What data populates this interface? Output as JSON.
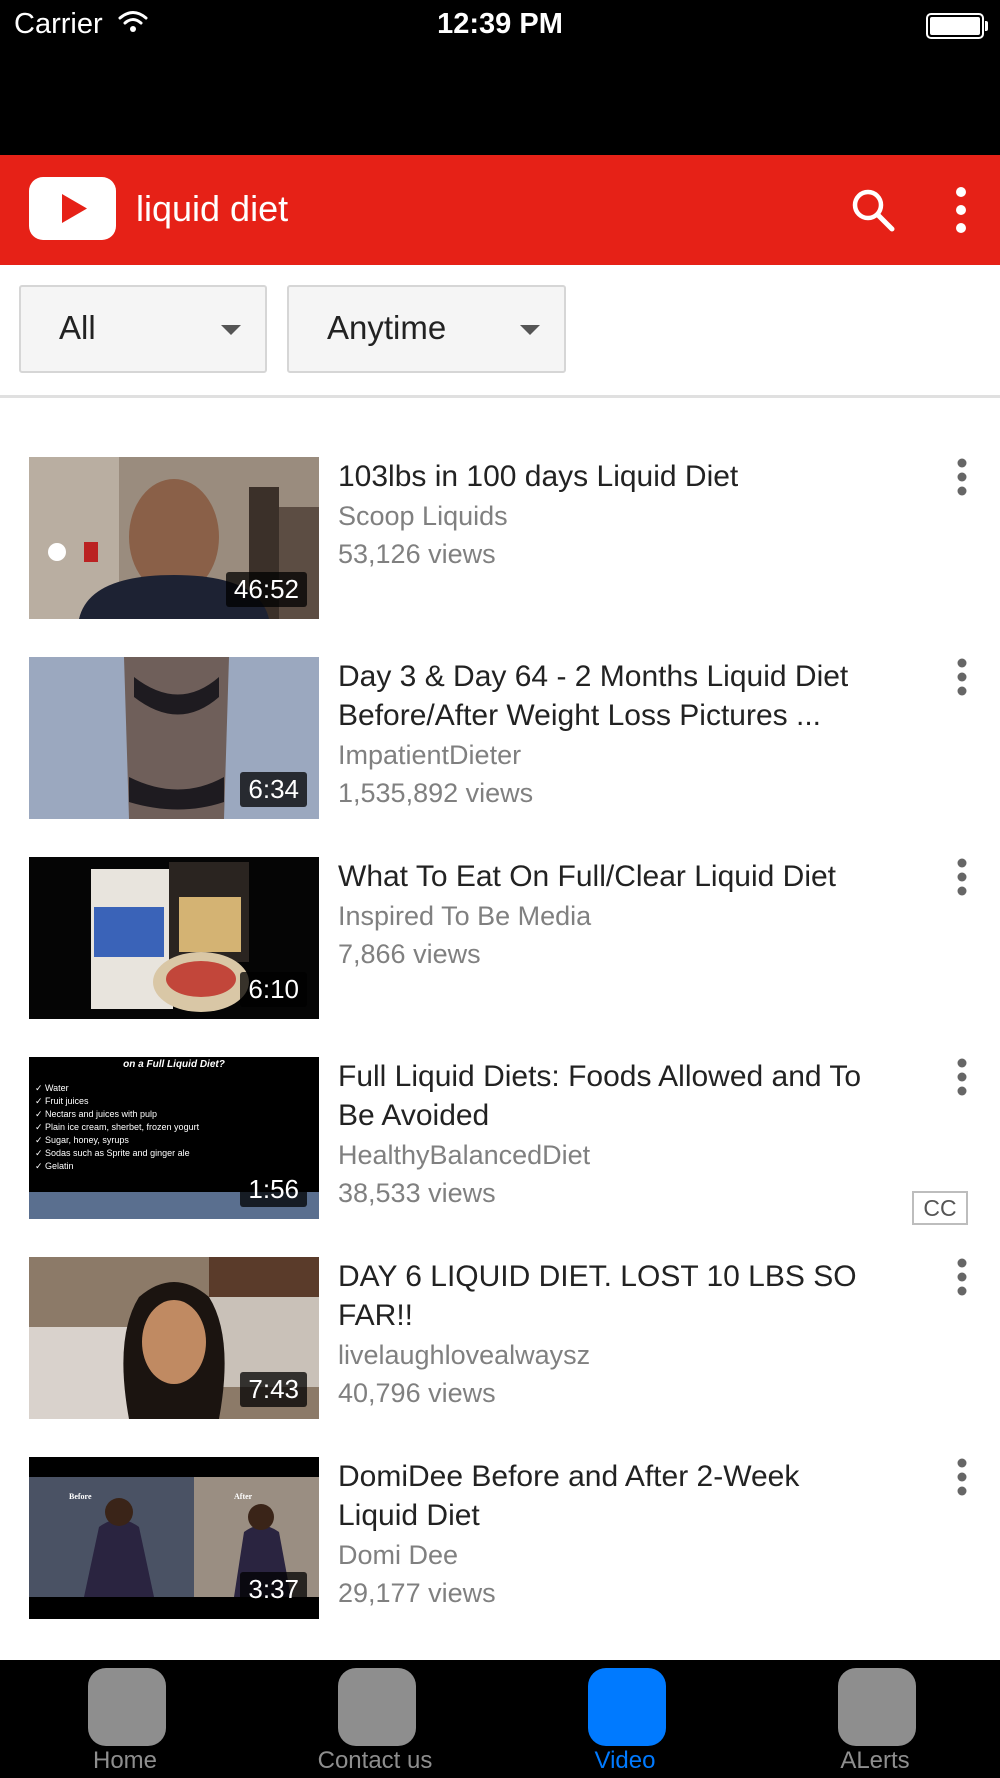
{
  "status_bar": {
    "carrier": "Carrier",
    "time": "12:39 PM"
  },
  "header": {
    "query": "liquid diet",
    "brand_color": "#e62117"
  },
  "filters": [
    {
      "label": "All"
    },
    {
      "label": "Anytime"
    }
  ],
  "results": [
    {
      "title": "103lbs in 100 days Liquid Diet",
      "channel": "Scoop Liquids",
      "views": "53,126 views",
      "duration": "46:52"
    },
    {
      "title": "Day 3 & Day 64 - 2 Months Liquid Diet Before/After Weight Loss Pictures ...",
      "channel": "ImpatientDieter",
      "views": "1,535,892 views",
      "duration": "6:34"
    },
    {
      "title": "What To Eat On Full/Clear Liquid Diet",
      "channel": "Inspired To Be Media",
      "views": "7,866 views",
      "duration": "6:10"
    },
    {
      "title": "Full Liquid Diets: Foods Allowed and To Be Avoided",
      "channel": "HealthyBalancedDiet",
      "views": "38,533 views",
      "duration": "1:56",
      "badge": "CC",
      "thumb_text": {
        "heading": "on a Full Liquid Diet?",
        "items": [
          "Water",
          "Fruit juices",
          "Nectars and juices with pulp",
          "Plain ice cream, sherbet, frozen yogurt",
          "Sugar, honey, syrups",
          "Sodas such as Sprite and ginger ale",
          "Gelatin"
        ]
      }
    },
    {
      "title": "DAY 6 LIQUID DIET. LOST 10 LBS SO FAR!!",
      "channel": "livelaughlovealwaysz",
      "views": "40,796 views",
      "duration": "7:43"
    },
    {
      "title": "DomiDee Before and After 2-Week Liquid Diet",
      "channel": "Domi Dee",
      "views": "29,177 views",
      "duration": "3:37",
      "thumb_text": {
        "left": "Before",
        "right": "After"
      }
    }
  ],
  "tabs": [
    {
      "label": "Home",
      "active": false
    },
    {
      "label": "Contact us",
      "active": false
    },
    {
      "label": "Video",
      "active": true
    },
    {
      "label": "ALerts",
      "active": false
    }
  ],
  "colors": {
    "active_tab": "#007aff",
    "inactive_tab": "#8e8e8e"
  }
}
